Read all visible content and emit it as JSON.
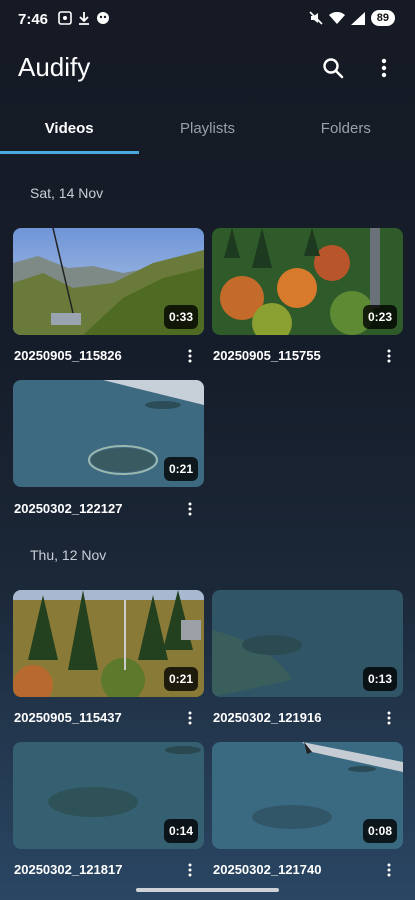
{
  "status": {
    "time": "7:46",
    "battery": "89"
  },
  "app": {
    "title": "Audify"
  },
  "tabs": [
    {
      "label": "Videos",
      "active": true
    },
    {
      "label": "Playlists",
      "active": false
    },
    {
      "label": "Folders",
      "active": false
    }
  ],
  "sections": [
    {
      "date": "Sat, 14 Nov",
      "videos": [
        {
          "name": "20250905_115826",
          "duration": "0:33"
        },
        {
          "name": "20250905_115755",
          "duration": "0:23"
        },
        {
          "name": "20250302_122127",
          "duration": "0:21"
        }
      ]
    },
    {
      "date": "Thu, 12 Nov",
      "videos": [
        {
          "name": "20250905_115437",
          "duration": "0:21"
        },
        {
          "name": "20250302_121916",
          "duration": "0:13"
        },
        {
          "name": "20250302_121817",
          "duration": "0:14"
        },
        {
          "name": "20250302_121740",
          "duration": "0:08"
        }
      ]
    }
  ],
  "colors": {
    "accent": "#4aa8e0",
    "background": "#161d2a"
  }
}
